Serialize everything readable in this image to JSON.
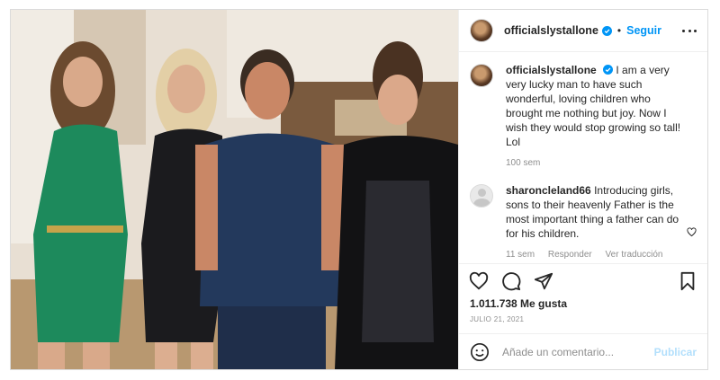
{
  "post": {
    "username": "officialslystallone",
    "follow_label": "Seguir",
    "separator": "•",
    "caption": "I am a very very lucky man to have such wonderful, loving children who brought me nothing but joy. Now I wish they would stop growing so tall! Lol",
    "caption_age": "100 sem",
    "comments": [
      {
        "username": "sharoncleland66",
        "text": "Introducing girls, sons to their heavenly Father is the most important thing a father can do for his children.",
        "age": "11 sem",
        "reply_label": "Responder",
        "translate_label": "Ver traducción"
      }
    ],
    "likes": "1.011.738 Me gusta",
    "date": "JULIO 21, 2021",
    "comment_placeholder": "Añade un comentario...",
    "publish_label": "Publicar"
  },
  "colors": {
    "accent": "#0095f6",
    "verified": "#0095f6",
    "muted": "#8e8e8e",
    "publish_disabled": "#b2dffc"
  }
}
